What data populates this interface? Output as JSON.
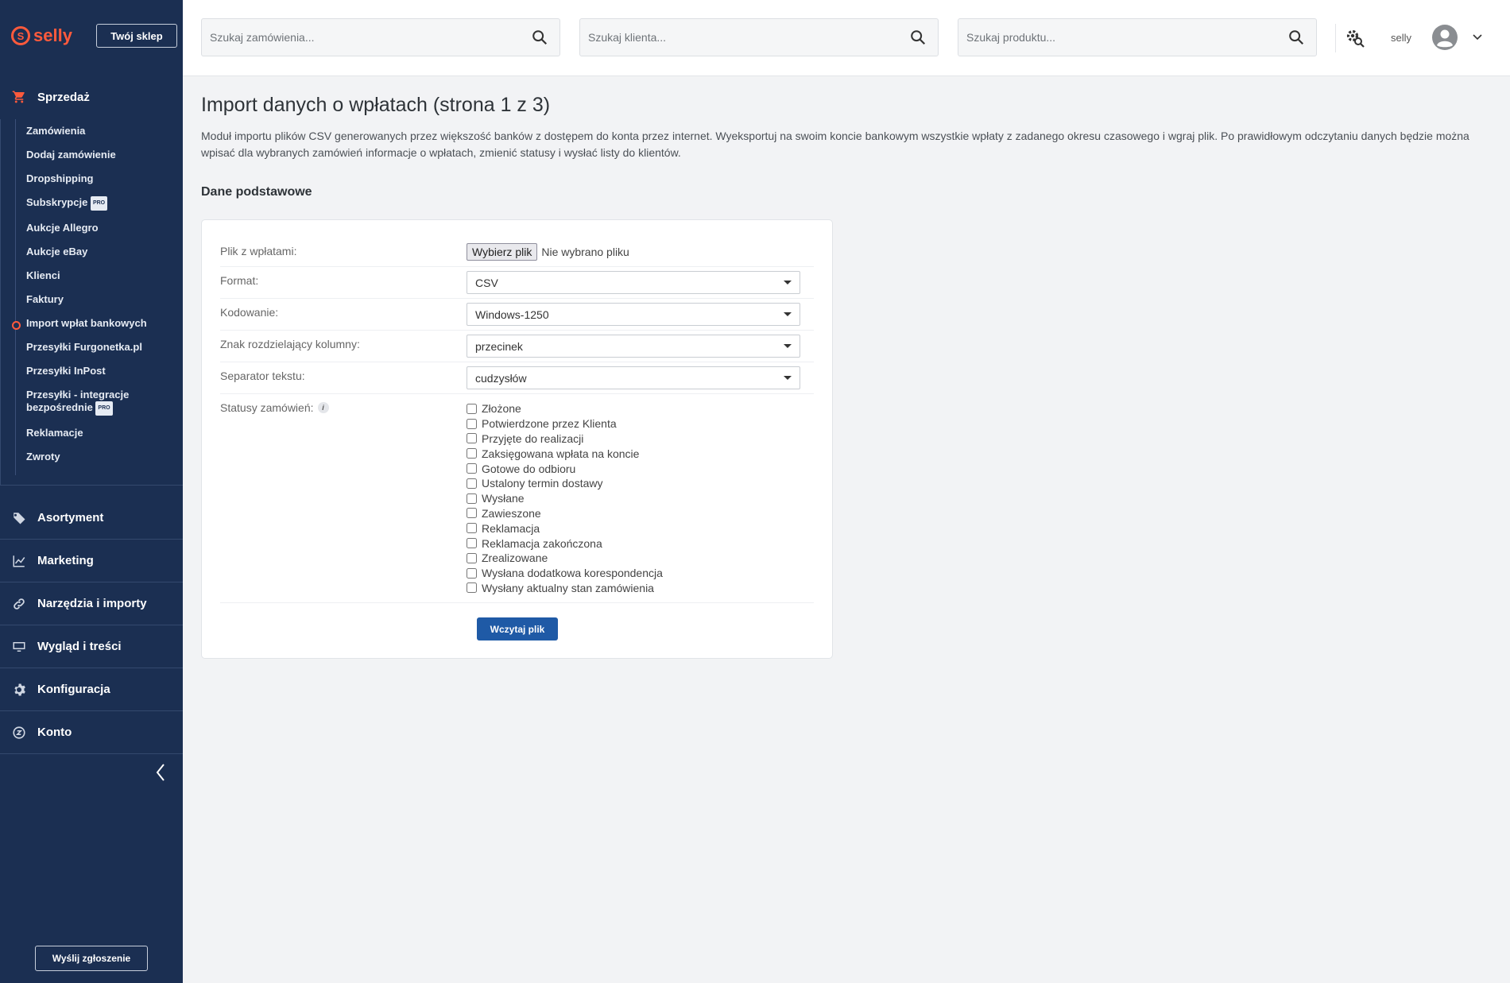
{
  "brand": {
    "logo_text": "selly",
    "shop_button": "Twój sklep"
  },
  "sidebar": {
    "open_section": "Sprzedaż",
    "sales_items": [
      {
        "label": "Zamówienia"
      },
      {
        "label": "Dodaj zamówienie"
      },
      {
        "label": "Dropshipping"
      },
      {
        "label": "Subskrypcje",
        "badge": "PRO"
      },
      {
        "label": "Aukcje Allegro"
      },
      {
        "label": "Aukcje eBay"
      },
      {
        "label": "Klienci"
      },
      {
        "label": "Faktury"
      },
      {
        "label": "Import wpłat bankowych",
        "active": true
      },
      {
        "label": "Przesyłki Furgonetka.pl"
      },
      {
        "label": "Przesyłki InPost"
      },
      {
        "label": "Przesyłki - integracje bezpośrednie",
        "badge": "PRO"
      },
      {
        "label": "Reklamacje"
      },
      {
        "label": "Zwroty"
      }
    ],
    "sections": [
      "Asortyment",
      "Marketing",
      "Narzędzia i importy",
      "Wygląd i treści",
      "Konfiguracja",
      "Konto"
    ],
    "report_button": "Wyślij zgłoszenie"
  },
  "header": {
    "search_orders_placeholder": "Szukaj zamówienia...",
    "search_clients_placeholder": "Szukaj klienta...",
    "search_products_placeholder": "Szukaj produktu...",
    "user_name": "selly"
  },
  "main": {
    "title": "Import danych o wpłatach (strona 1 z 3)",
    "description": "Moduł importu plików CSV generowanych przez większość banków z dostępem do konta przez internet. Wyeksportuj na swoim koncie bankowym wszystkie wpłaty z zadanego okresu czasowego i wgraj plik. Po prawidłowym odczytaniu danych będzie można wpisać dla wybranych zamówień informacje o wpłatach, zmienić statusy i wysłać listy do klientów.",
    "section_title": "Dane podstawowe",
    "form": {
      "file_label": "Plik z wpłatami:",
      "file_button": "Wybierz plik",
      "file_status": "Nie wybrano pliku",
      "format_label": "Format:",
      "format_value": "CSV",
      "encoding_label": "Kodowanie:",
      "encoding_value": "Windows-1250",
      "column_sep_label": "Znak rozdzielający kolumny:",
      "column_sep_value": "przecinek",
      "text_sep_label": "Separator tekstu:",
      "text_sep_value": "cudzysłów",
      "statuses_label": "Statusy zamówień:",
      "statuses": [
        "Złożone",
        "Potwierdzone przez Klienta",
        "Przyjęte do realizacji",
        "Zaksięgowana wpłata na koncie",
        "Gotowe do odbioru",
        "Ustalony termin dostawy",
        "Wysłane",
        "Zawieszone",
        "Reklamacja",
        "Reklamacja zakończona",
        "Zrealizowane",
        "Wysłana dodatkowa korespondencja",
        "Wysłany aktualny stan zamówienia"
      ],
      "submit": "Wczytaj plik"
    }
  },
  "colors": {
    "sidebar_bg": "#1b2f52",
    "accent": "#ff5a3c",
    "primary_button": "#1f5aa6"
  }
}
